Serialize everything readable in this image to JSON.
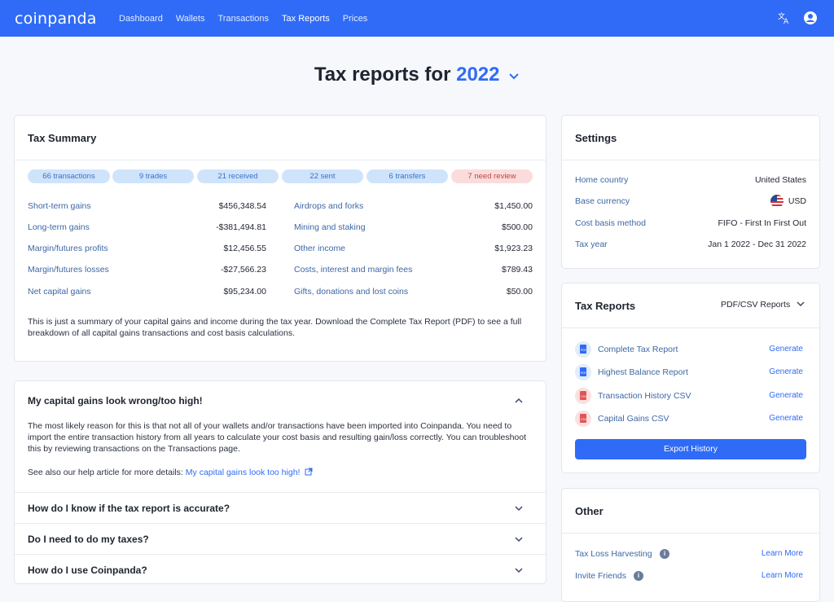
{
  "brand": {
    "logo": "coinpanda",
    "accent": "#2f6bf6"
  },
  "nav": [
    "Dashboard",
    "Wallets",
    "Transactions",
    "Tax Reports",
    "Prices"
  ],
  "title": {
    "prefix": "Tax reports for",
    "year": "2022"
  },
  "summary": {
    "heading": "Tax Summary",
    "pills": [
      "66 transactions",
      "9 trades",
      "21 received",
      "22 sent",
      "6 transfers",
      "7 need review"
    ],
    "left": [
      {
        "label": "Short-term gains",
        "value": "$456,348.54"
      },
      {
        "label": "Long-term gains",
        "value": "-$381,494.81"
      },
      {
        "label": "Margin/futures profits",
        "value": "$12,456.55"
      },
      {
        "label": "Margin/futures losses",
        "value": "-$27,566.23"
      },
      {
        "label": "Net capital gains",
        "value": "$95,234.00"
      }
    ],
    "right": [
      {
        "label": "Airdrops and forks",
        "value": "$1,450.00"
      },
      {
        "label": "Mining and staking",
        "value": "$500.00"
      },
      {
        "label": "Other income",
        "value": "$1,923.23"
      },
      {
        "label": "Costs, interest and margin fees",
        "value": "$789.43"
      },
      {
        "label": "Gifts, donations and lost coins",
        "value": "$50.00"
      }
    ],
    "note": "This is just a summary of your capital gains and income during the tax year. Download the Complete Tax Report (PDF) to see a full breakdown of all capital gains transactions and cost basis calculations."
  },
  "faq": [
    {
      "q": "My capital gains look wrong/too high!",
      "a": "The most likely reason for this is that not all of your wallets and/or transactions have been imported into Coinpanda. You need to import the entire transaction history from all years to calculate your cost basis and resulting gain/loss correctly. You can troubleshoot this by reviewing transactions on the Transactions page.",
      "see_also": "See also our help article for more details:",
      "link": "My capital gains look too high!"
    },
    {
      "q": "How do I know if the tax report is accurate?"
    },
    {
      "q": "Do I need to do my taxes?"
    },
    {
      "q": "How do I use Coinpanda?"
    }
  ],
  "settings": {
    "heading": "Settings",
    "rows": [
      {
        "label": "Home country",
        "value": "United States"
      },
      {
        "label": "Base currency",
        "value": "USD"
      },
      {
        "label": "Cost basis method",
        "value": "FIFO - First In First Out"
      },
      {
        "label": "Tax year",
        "value": "Jan 1 2022 - Dec 31 2022"
      }
    ]
  },
  "reports": {
    "heading": "Tax Reports",
    "dropdown": "PDF/CSV Reports",
    "items": [
      {
        "label": "Complete Tax Report",
        "icon": "PDF",
        "action": "Generate"
      },
      {
        "label": "Highest Balance Report",
        "icon": "PDF",
        "action": "Generate"
      },
      {
        "label": "Transaction History CSV",
        "icon": "CSV",
        "action": "Generate"
      },
      {
        "label": "Capital Gains CSV",
        "icon": "CSV",
        "action": "Generate"
      }
    ],
    "export": "Export History"
  },
  "other": {
    "heading": "Other",
    "items": [
      {
        "label": "Tax Loss Harvesting",
        "action": "Learn More"
      },
      {
        "label": "Invite Friends",
        "action": "Learn More"
      }
    ]
  }
}
